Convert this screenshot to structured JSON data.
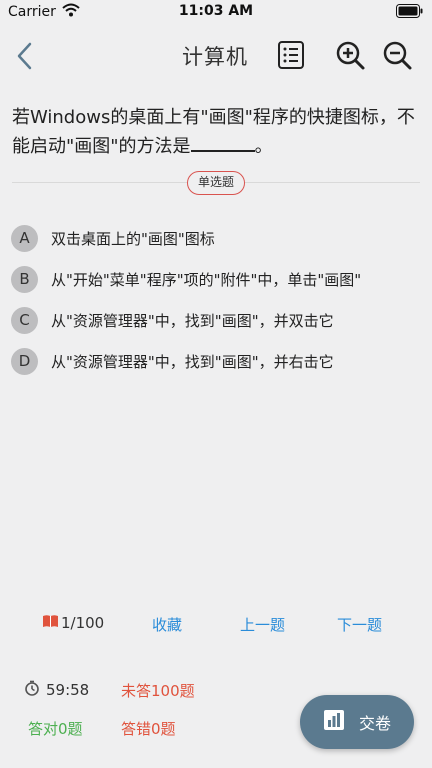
{
  "status_bar": {
    "carrier": "Carrier",
    "time": "11:03 AM"
  },
  "nav": {
    "title": "计算机"
  },
  "question": {
    "text": "若Windows的桌面上有\"画图\"程序的快捷图标，不能启动\"画图\"的方法是",
    "after_blank": "。",
    "type": "单选题"
  },
  "options": [
    {
      "letter": "A",
      "text": "双击桌面上的\"画图\"图标"
    },
    {
      "letter": "B",
      "text": "从\"开始\"菜单\"程序\"项的\"附件\"中，单击\"画图\""
    },
    {
      "letter": "C",
      "text": "从\"资源管理器\"中，找到\"画图\"，并双击它"
    },
    {
      "letter": "D",
      "text": "从\"资源管理器\"中，找到\"画图\"，并右击它"
    }
  ],
  "footer": {
    "progress": "1/100",
    "favorite": "收藏",
    "prev": "上一题",
    "next": "下一题"
  },
  "stats": {
    "timer": "59:58",
    "unanswered": "未答100题",
    "correct": "答对0题",
    "wrong": "答错0题"
  },
  "submit": {
    "label": "交卷"
  },
  "colors": {
    "link": "#2a8cd9",
    "unanswered": "#e0533d",
    "correct": "#4caf50",
    "wrong": "#e0533d",
    "submit_bg": "#5b7a8f",
    "nav_accent": "#5b7a8f"
  }
}
